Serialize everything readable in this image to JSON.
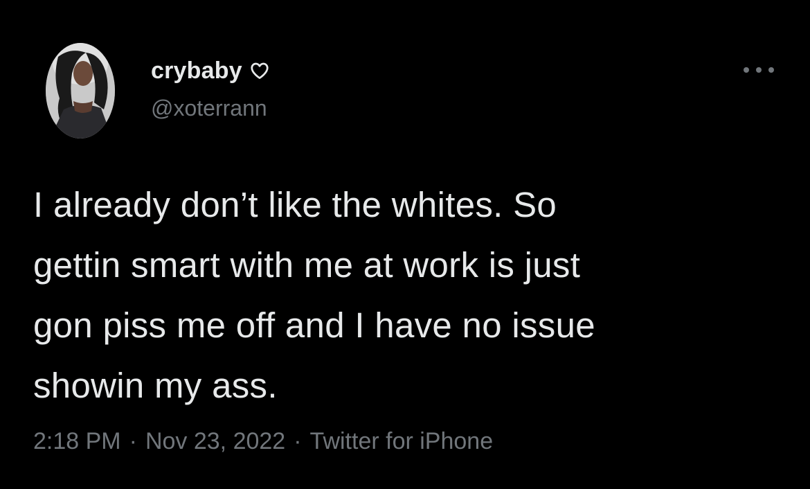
{
  "author": {
    "display_name": "crybaby",
    "badge_icon": "heart-outline-icon",
    "handle": "@xoterrann"
  },
  "menu": {
    "icon": "more-options-icon"
  },
  "tweet": {
    "text": "I already don’t like the whites. So\ngettin smart with me at work is just\ngon piss me off and I have no issue\nshowin my ass.",
    "time": "2:18 PM",
    "separator": "·",
    "date": "Nov 23, 2022",
    "source": "Twitter for iPhone"
  },
  "colors": {
    "background": "#000000",
    "primary_text": "#e7e9ea",
    "secondary_text": "#71767b"
  }
}
